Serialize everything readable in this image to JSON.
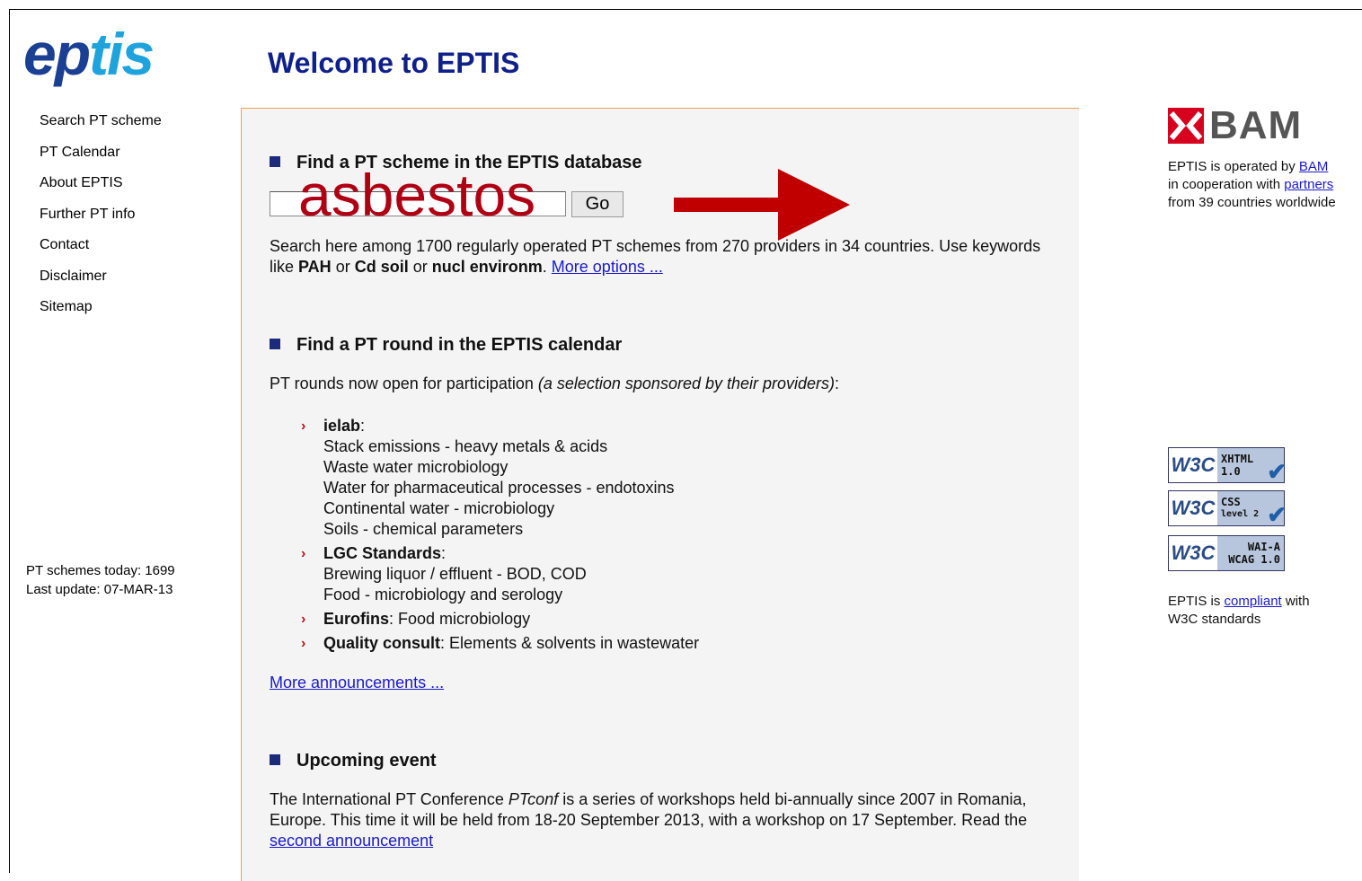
{
  "logo": {
    "part1": "ep",
    "part2": "tis"
  },
  "nav": [
    {
      "label": "Search PT scheme"
    },
    {
      "label": "PT Calendar"
    },
    {
      "label": "About EPTIS"
    },
    {
      "label": "Further PT info"
    },
    {
      "label": "Contact"
    },
    {
      "label": "Disclaimer"
    },
    {
      "label": "Sitemap"
    }
  ],
  "stats": {
    "schemes": "PT schemes today: 1699",
    "update": "Last update: 07-MAR-13"
  },
  "title": "Welcome to EPTIS",
  "search_section": {
    "heading": "Find a PT scheme in the EPTIS database",
    "input_value": "asbestos",
    "go_label": "Go",
    "desc_1": "Search here among 1700 regularly operated PT schemes from 270 providers in 34 countries. Use keywords like ",
    "kw1": "PAH",
    "or1": " or ",
    "kw2": "Cd soil",
    "or2": " or ",
    "kw3": "nucl environm",
    "desc_end": ". ",
    "more_options": "More options ..."
  },
  "calendar_section": {
    "heading": "Find a PT round in the EPTIS calendar",
    "intro": "PT rounds now open for participation ",
    "intro_italic": "(a selection sponsored by their providers)",
    "intro_colon": ":",
    "providers": [
      {
        "name": "ielab",
        "suffix": ":",
        "items": [
          "Stack emissions - heavy metals & acids",
          "Waste water microbiology",
          "Water for pharmaceutical processes - endotoxins",
          "Continental water - microbiology",
          "Soils - chemical parameters"
        ]
      },
      {
        "name": "LGC Standards",
        "suffix": ":",
        "items": [
          "Brewing liquor / effluent - BOD, COD",
          "Food - microbiology and serology"
        ]
      },
      {
        "name": "Eurofins",
        "suffix": ": Food microbiology",
        "items": []
      },
      {
        "name": "Quality consult",
        "suffix": ": Elements & solvents in wastewater",
        "items": []
      }
    ],
    "more_announcements": "More announcements ..."
  },
  "event_section": {
    "heading": "Upcoming event",
    "text_1": "The International PT Conference ",
    "text_italic": "PTconf",
    "text_2": " is a series of workshops held bi-annually since 2007 in Romania, Europe. This time it will be held from 18-20 September 2013, with a workshop on 17 September. Read the ",
    "link": "second announcement"
  },
  "right": {
    "bam_label": "BAM",
    "operated_1": "EPTIS is operated by ",
    "operated_link": "BAM",
    "coop_1": "in cooperation with ",
    "coop_link": "partners",
    "countries": "from 39 countries worldwide",
    "badges": [
      {
        "left": "W3C",
        "top": "XHTML",
        "bottom": "1.0"
      },
      {
        "left": "W3C",
        "top": "CSS",
        "bottom": "level 2"
      },
      {
        "left": "W3C",
        "top": "WAI-A",
        "bottom": "WCAG 1.0"
      }
    ],
    "compliant_1": "EPTIS is ",
    "compliant_link": "compliant",
    "compliant_2": " with",
    "compliant_3": "W3C standards"
  },
  "colors": {
    "title": "#10208a",
    "panel_border": "#f0a050",
    "arrow": "#c00000",
    "link": "#1a1acc"
  }
}
